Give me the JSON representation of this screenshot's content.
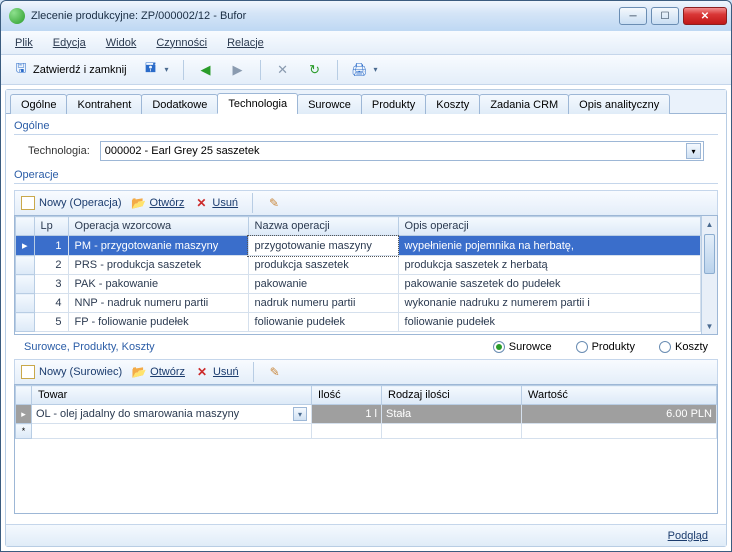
{
  "window": {
    "title": "Zlecenie produkcyjne: ZP/000002/12 - Bufor"
  },
  "menu": {
    "plik": "Plik",
    "edycja": "Edycja",
    "widok": "Widok",
    "czynnosci": "Czynności",
    "relacje": "Relacje"
  },
  "toolbar": {
    "confirm": "Zatwierdź i zamknij"
  },
  "tabs": {
    "ogolne": "Ogólne",
    "kontrahent": "Kontrahent",
    "dodatkowe": "Dodatkowe",
    "technologia": "Technologia",
    "surowce": "Surowce",
    "produkty": "Produkty",
    "koszty": "Koszty",
    "zadania": "Zadania CRM",
    "opis": "Opis analityczny"
  },
  "tech": {
    "group": "Ogólne",
    "label": "Technologia:",
    "value": "000002 - Earl Grey 25 saszetek"
  },
  "ops": {
    "group": "Operacje",
    "btn_new": "Nowy (Operacja)",
    "btn_open": "Otwórz",
    "btn_del": "Usuń",
    "cols": {
      "lp": "Lp",
      "wz": "Operacja wzorcowa",
      "nazwa": "Nazwa operacji",
      "opis": "Opis operacji"
    },
    "rows": [
      {
        "lp": "1",
        "wz": "PM - przygotowanie maszyny",
        "nazwa": "przygotowanie maszyny",
        "opis": "wypełnienie pojemnika na herbatę,"
      },
      {
        "lp": "2",
        "wz": "PRS - produkcja saszetek",
        "nazwa": "produkcja saszetek",
        "opis": "produkcja saszetek z herbatą"
      },
      {
        "lp": "3",
        "wz": "PAK - pakowanie",
        "nazwa": "pakowanie",
        "opis": "pakowanie saszetek do pudełek"
      },
      {
        "lp": "4",
        "wz": "NNP - nadruk numeru partii",
        "nazwa": "nadruk numeru partii",
        "opis": "wykonanie nadruku z numerem partii i"
      },
      {
        "lp": "5",
        "wz": "FP - foliowanie pudełek",
        "nazwa": "foliowanie pudełek",
        "opis": "foliowanie pudełek"
      }
    ]
  },
  "spk": {
    "label": "Surowce, Produkty, Koszty",
    "r_surowce": "Surowce",
    "r_produkty": "Produkty",
    "r_koszty": "Koszty"
  },
  "mat": {
    "btn_new": "Nowy (Surowiec)",
    "btn_open": "Otwórz",
    "btn_del": "Usuń",
    "cols": {
      "towar": "Towar",
      "ilosc": "Ilość",
      "rodzaj": "Rodzaj ilości",
      "wartosc": "Wartość"
    },
    "rows": [
      {
        "towar": "OL - olej jadalny do smarowania maszyny",
        "ilosc": "1 l",
        "rodzaj": "Stała",
        "wartosc": "6.00 PLN"
      }
    ]
  },
  "status": {
    "podglad": "Podgląd"
  }
}
